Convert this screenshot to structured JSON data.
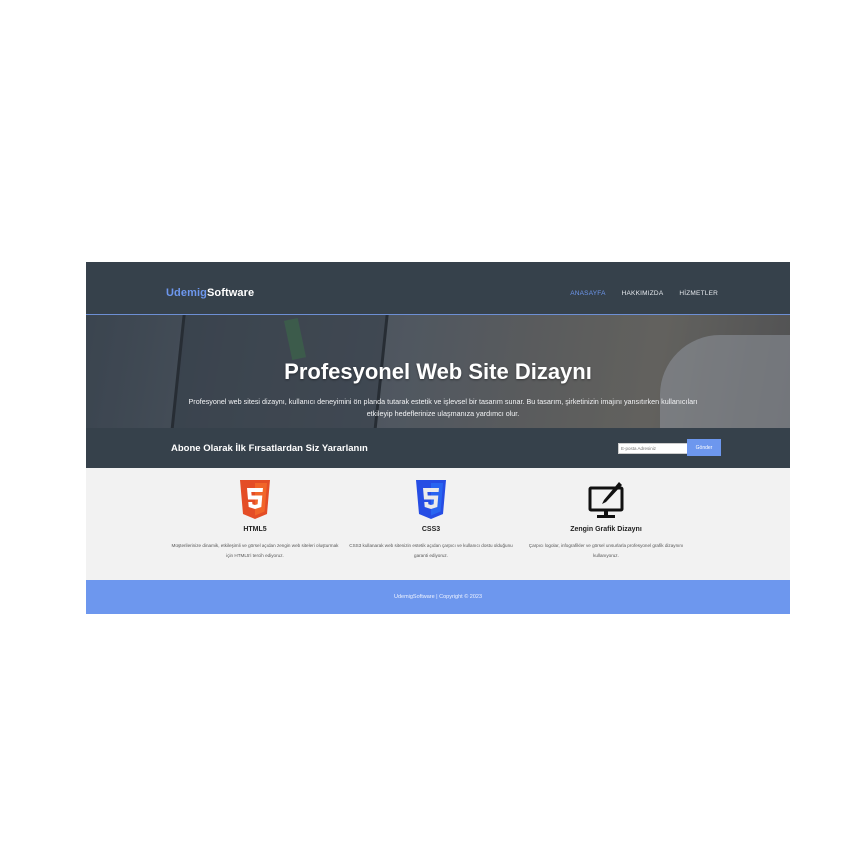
{
  "brand": {
    "part1": "Udemig",
    "part2": "Software"
  },
  "nav": {
    "items": [
      "ANASAYFA",
      "HAKKIMIZDA",
      "HİZMETLER"
    ],
    "active": "ANASAYFA"
  },
  "hero": {
    "title": "Profesyonel Web Site Dizaynı",
    "text": "Profesyonel web sitesi dizaynı, kullanıcı deneyimini ön planda tutarak estetik ve işlevsel bir tasarım sunar. Bu tasarım, şirketinizin imajını yansıtırken kullanıcıları etkileyip hedeflerinize ulaşmanıza yardımcı olur."
  },
  "subscribe": {
    "title": "Abone Olarak İlk Fırsatlardan Siz Yararlanın",
    "placeholder": "E-posta Adresiniz",
    "button": "Gönder"
  },
  "features": [
    {
      "title": "HTML5",
      "text": "Müşterilerinize dinamik, etkileşimli ve görsel açıdan zengin web siteleri oluşturmak için HTML5'i tercih ediyoruz."
    },
    {
      "title": "CSS3",
      "text": "CSS3 kullanarak web sitenizin estetik açıdan çarpıcı ve kullanıcı dostu olduğunu garanti ediyoruz."
    },
    {
      "title": "Zengin Grafik Dizaynı",
      "text": "Çarpıcı logolar, infografikler ve görsel unsurlarla profesyonel grafik dizaynını kullanıyoruz."
    }
  ],
  "footer": {
    "text": "UdemigSoftware | Copyright © 2023"
  },
  "colors": {
    "accent": "#6d97ee",
    "dark": "#36414b",
    "html5": "#e44d26",
    "css3": "#264de4"
  }
}
